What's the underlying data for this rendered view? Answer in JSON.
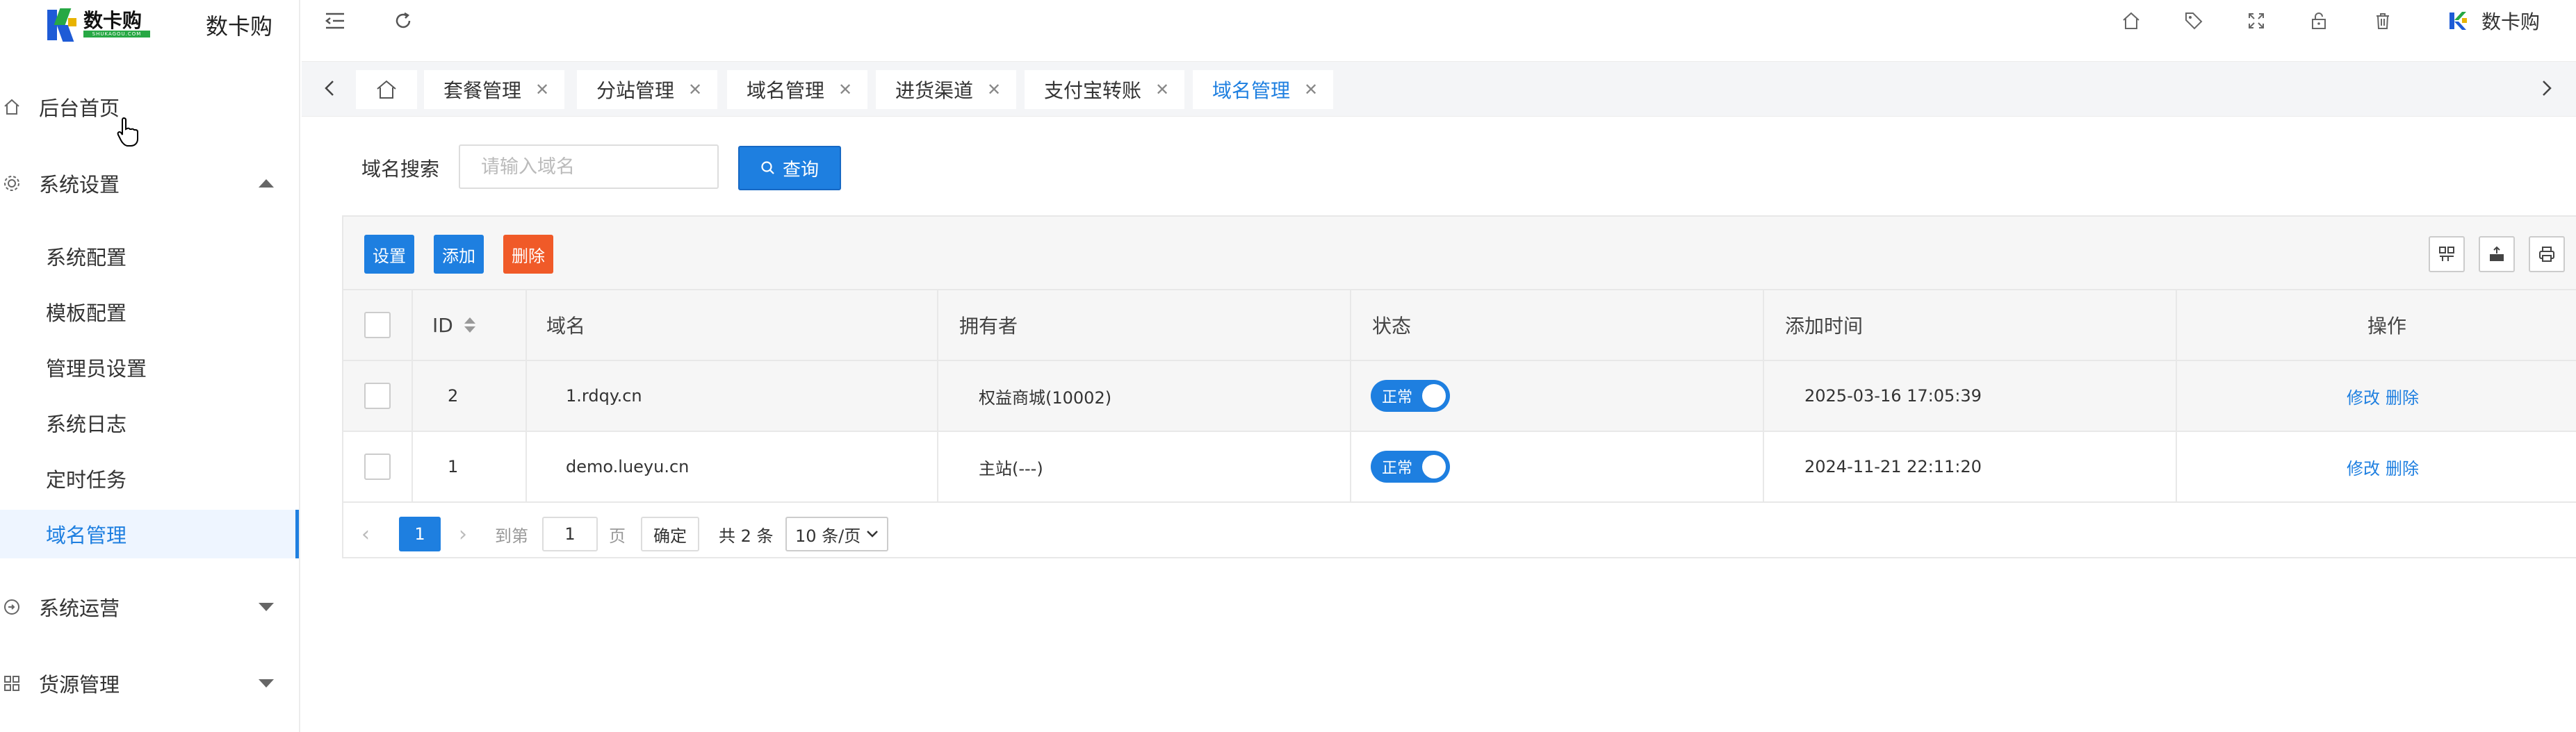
{
  "app": {
    "logo_text": "数卡购",
    "logo_sub": "SHUKAGOU.COM",
    "name": "数卡购"
  },
  "sidebar": {
    "items": [
      {
        "label": "后台首页",
        "icon": "home-icon"
      },
      {
        "label": "系统设置",
        "icon": "gear-icon",
        "expanded": true,
        "children": [
          "系统配置",
          "模板配置",
          "管理员设置",
          "系统日志",
          "定时任务",
          "域名管理"
        ]
      },
      {
        "label": "系统运营",
        "icon": "operation-icon",
        "expanded": false
      },
      {
        "label": "货源管理",
        "icon": "grid-icon",
        "expanded": false
      }
    ],
    "active_child": "域名管理"
  },
  "header": {
    "icons": [
      "collapse-menu-icon",
      "refresh-icon",
      "home-icon",
      "tag-icon",
      "fullscreen-icon",
      "lock-icon",
      "trash-icon"
    ],
    "user_name": "数卡购"
  },
  "tabs": [
    {
      "label": "套餐管理"
    },
    {
      "label": "分站管理"
    },
    {
      "label": "域名管理"
    },
    {
      "label": "进货渠道"
    },
    {
      "label": "支付宝转账"
    },
    {
      "label": "域名管理",
      "active": true
    }
  ],
  "search": {
    "label": "域名搜索",
    "placeholder": "请输入域名",
    "value": "",
    "button": "查询"
  },
  "toolbar": {
    "settings": "设置",
    "add": "添加",
    "delete": "删除",
    "right_icons": [
      "columns-icon",
      "export-icon",
      "print-icon"
    ]
  },
  "table": {
    "columns": [
      "ID",
      "域名",
      "拥有者",
      "状态",
      "添加时间",
      "操作"
    ],
    "rows": [
      {
        "id": "2",
        "domain": "1.rdqy.cn",
        "owner": "权益商城(10002)",
        "status": "正常",
        "time": "2025-03-16 17:05:39",
        "edit": "修改",
        "del": "删除"
      },
      {
        "id": "1",
        "domain": "demo.lueyu.cn",
        "owner": "主站(---)",
        "status": "正常",
        "time": "2024-11-21 22:11:20",
        "edit": "修改",
        "del": "删除"
      }
    ]
  },
  "pager": {
    "current": "1",
    "goto_label": "到第",
    "goto_value": "1",
    "page_unit": "页",
    "confirm": "确定",
    "total": "共 2 条",
    "page_size": "10 条/页"
  },
  "colors": {
    "accent": "#1e7fe0",
    "danger": "#f05a28",
    "sidebar_active_bg": "#eef5ff"
  }
}
